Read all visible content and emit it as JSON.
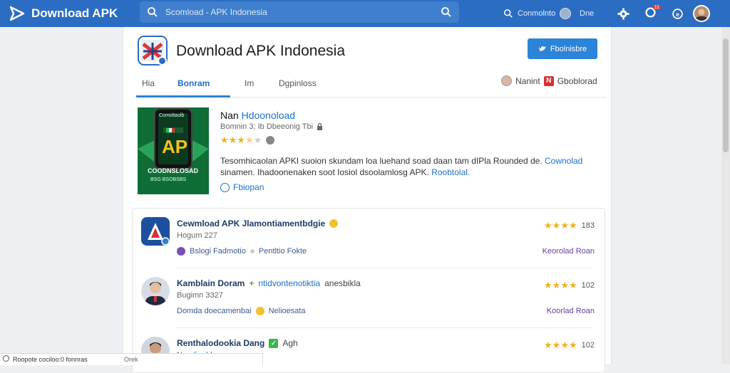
{
  "brand": {
    "name": "Download APK",
    "color": "#2a6dc2"
  },
  "search": {
    "text": "Scomload - APK Indonesia"
  },
  "topbar": {
    "account_text": "Conmolnto",
    "lang_text": "Dne",
    "notification_count": "11"
  },
  "page": {
    "title": "Download APK Indonesia",
    "follow_label": "Fbolnisbre"
  },
  "tabs": [
    {
      "label": "Hia"
    },
    {
      "label": "Bonram"
    },
    {
      "label": "Im"
    },
    {
      "label": "Dgpinloss"
    }
  ],
  "tab_right": {
    "user_label": "Nanint",
    "download_tag": "N",
    "download_label": "Gboblorad"
  },
  "featured": {
    "image_big_text": "AP",
    "image_caption_top": "Comoltaolb",
    "image_caption_bottom": "COODNSLOSAD",
    "image_caption_sub": "BSG BSOBSBS",
    "name_prefix": "Nan",
    "name_highlight": "Hdoonoload",
    "meta": "Bomnin 3; Ib Dbeeonig Tbi",
    "rating": 3.5,
    "description": "Tesomhicaolan APKI suoion skundam loa luehand soad daan tam dIPla Rounded de.",
    "description_link1": "Cownolad",
    "description_line2": "sinamen. Ihadoonenaken soot Iosiol dsoolamlosg APK.",
    "description_link2": "Roobtolal.",
    "link_label": "Fbiopan"
  },
  "reviews": [
    {
      "title": "Cewmload APK Jlamontiamentbdgie",
      "title_extra": "",
      "title_extra2": "",
      "sub": "Hogum 227",
      "meta1": "Bslogi Fadmotio",
      "meta2": "Pentltio Fokte",
      "rating_value": "183",
      "action": "Keorolad Roan"
    },
    {
      "title": "Kamblain Doram",
      "title_extra": "ntidvontenotiktia",
      "title_extra2": "anesbikla",
      "sub": "Bugimn 3327",
      "meta1": "Domda doecamenbai",
      "meta2": "Nelioesata",
      "rating_value": "102",
      "action": "Koorlad Roan"
    },
    {
      "title": "Renthalodookia Dang",
      "title_extra": "Agh",
      "title_extra2": "",
      "sub": "Nendim hhe",
      "meta1": "",
      "meta2": "",
      "rating_value": "102",
      "action": ""
    }
  ],
  "status_bar": {
    "left_text": "Roopote cociloo:0 fonnras",
    "right_text": "Orek"
  }
}
